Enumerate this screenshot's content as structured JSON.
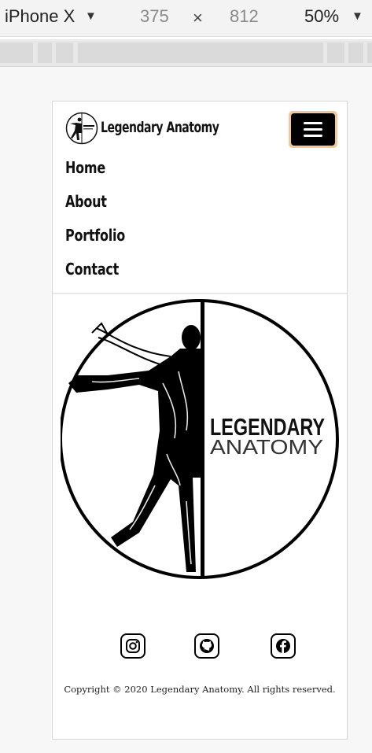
{
  "devtools": {
    "device": "iPhone X",
    "width": "375",
    "times": "×",
    "height": "812",
    "zoom": "50%"
  },
  "site": {
    "brand": "Legendary Anatomy",
    "nav": [
      "Home",
      "About",
      "Portfolio",
      "Contact"
    ],
    "hero_logo": {
      "line1": "LEGENDARY",
      "line2": "ANATOMY"
    },
    "social_icons": [
      "instagram-icon",
      "github-icon",
      "facebook-icon"
    ],
    "copyright": "Copyright © 2020 Legendary Anatomy. All rights reserved."
  }
}
